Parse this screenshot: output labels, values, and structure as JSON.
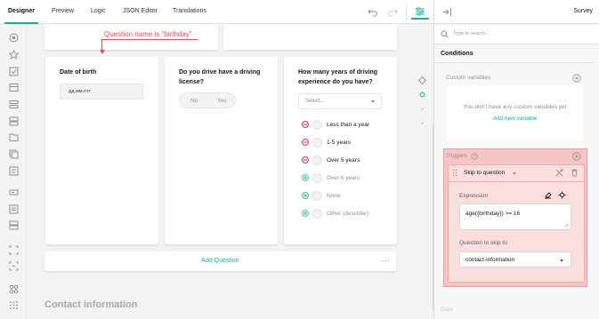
{
  "tabs": [
    {
      "label": "Designer",
      "active": true
    },
    {
      "label": "Preview"
    },
    {
      "label": "Logic"
    },
    {
      "label": "JSON Editor"
    },
    {
      "label": "Translations"
    }
  ],
  "toolbar_icons": [
    "undo-icon",
    "redo-icon",
    "settings-icon"
  ],
  "toolbox_icons": [
    "radiogroup-icon",
    "rating-icon",
    "checkbox-icon",
    "dropdown-icon",
    "tagbox-icon",
    "boolean-icon",
    "file-icon",
    "image-picker-icon",
    "ranking-icon",
    "text-icon",
    "comment-icon",
    "multiple-text-icon",
    "panel-icon",
    "dynamic-panel-icon",
    "matrix-icon",
    "more-icon"
  ],
  "annotation": "Question name is \"birthday\"",
  "questions": {
    "birth": {
      "title": "Date of birth",
      "placeholder": "дд.мм.гггг"
    },
    "drive": {
      "title_line1": "Do you drive have a driving",
      "title_line2": "license?",
      "no": "No",
      "yes": "Yes"
    },
    "years": {
      "title_line1": "How many years of driving",
      "title_line2": "experience do you have?",
      "select_placeholder": "Select...",
      "choices": [
        {
          "label": "Less than a year",
          "action": "remove"
        },
        {
          "label": "1-5 years",
          "action": "remove"
        },
        {
          "label": "Over 5 years",
          "action": "remove"
        },
        {
          "label": "Over 6 years",
          "action": "add"
        },
        {
          "label": "None",
          "action": "add"
        },
        {
          "label": "Other (describe)",
          "action": "add"
        }
      ]
    }
  },
  "add_question": "Add Question",
  "add_question_more": "···",
  "next_page_title": "Contact information",
  "panel": {
    "title": "Survey",
    "search_placeholder": "Type to search...",
    "section": "Conditions",
    "custom_variables_label": "Custom variables",
    "no_variables_text": "You don't have any custom variables yet",
    "add_variable": "Add new variable",
    "triggers_label": "Triggers",
    "trigger_type": "Skip to question",
    "expression_label": "Expression",
    "expression_value": "age({birthday}) >= 16",
    "skip_to_label": "Question to skip to",
    "skip_to_value": "contact-information",
    "next_section": "Data"
  },
  "colors": {
    "accent": "#19b394",
    "remove": "#e60a3e",
    "highlight": "#f7c5c5",
    "annotation": "#e05050"
  }
}
